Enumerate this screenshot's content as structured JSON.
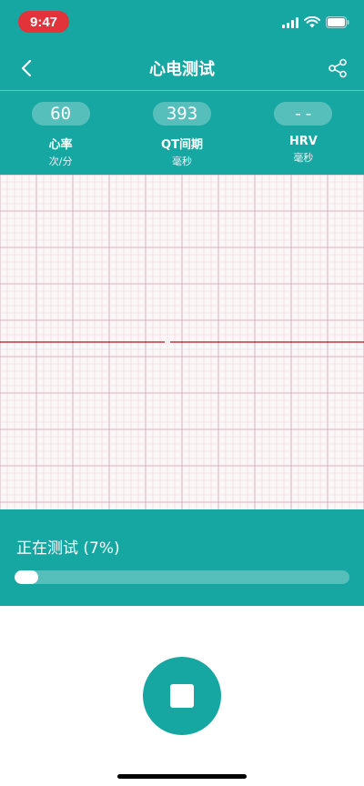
{
  "status_bar": {
    "time": "9:47",
    "icons": [
      "signal-icon",
      "wifi-icon",
      "battery-icon"
    ]
  },
  "nav": {
    "title": "心电测试",
    "back_icon": "chevron-left-icon",
    "share_icon": "share-icon"
  },
  "metrics": [
    {
      "value": "60",
      "label": "心率",
      "unit": "次/分"
    },
    {
      "value": "393",
      "label": "QT间期",
      "unit": "毫秒"
    },
    {
      "value": "--",
      "label": "HRV",
      "unit": "毫秒"
    }
  ],
  "progress": {
    "text": "正在测试 (7%)",
    "fraction": 0.07
  },
  "controls": {
    "stop_icon": "stop-icon"
  },
  "colors": {
    "primary": "#16a7a2",
    "time_pill": "#e2323a",
    "ecg_trace": "#b0141b",
    "grid_minor": "#ebd3d9",
    "grid_major": "#d6b1bb"
  }
}
